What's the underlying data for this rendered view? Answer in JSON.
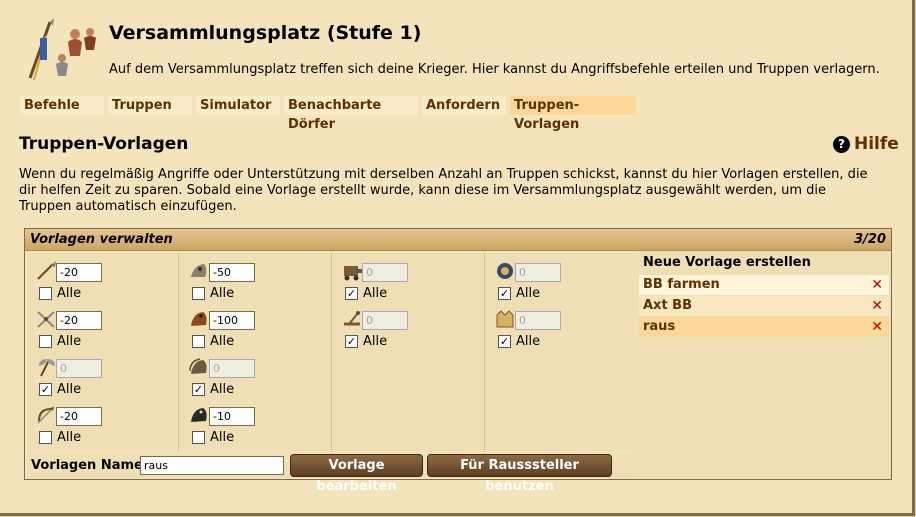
{
  "header": {
    "title": "Versammlungsplatz (Stufe 1)",
    "description": "Auf dem Versammlungsplatz treffen sich deine Krieger. Hier kannst du Angriffsbefehle erteilen und Truppen verlagern."
  },
  "tabs": [
    {
      "label": "Befehle",
      "selected": false
    },
    {
      "label": "Truppen",
      "selected": false
    },
    {
      "label": "Simulator",
      "selected": false
    },
    {
      "label": "Benachbarte Dörfer",
      "selected": false
    },
    {
      "label": "Anfordern",
      "selected": false
    },
    {
      "label": "Truppen-Vorlagen",
      "selected": true
    }
  ],
  "section": {
    "title": "Truppen-Vorlagen",
    "help_label": "Hilfe",
    "help_icon": "question-mark",
    "intro": "Wenn du regelmäßig Angriffe oder Unterstützung mit derselben Anzahl an Truppen schickst, kannst du hier Vorlagen erstellen, die dir helfen Zeit zu sparen. Sobald eine Vorlage erstellt wurde, kann diese im Versammlungsplatz ausgewählt werden, um die Truppen automatisch einzufügen."
  },
  "manage": {
    "title": "Vorlagen verwalten",
    "count": "3/20",
    "all_label": "Alle",
    "units": [
      {
        "unit": "spear",
        "value": "-20",
        "enabled": true,
        "all_checked": false
      },
      {
        "unit": "sword",
        "value": "-20",
        "enabled": true,
        "all_checked": false
      },
      {
        "unit": "axe",
        "value": "0",
        "enabled": false,
        "all_checked": true
      },
      {
        "unit": "archer",
        "value": "-20",
        "enabled": true,
        "all_checked": false
      },
      {
        "unit": "spy",
        "value": "-50",
        "enabled": true,
        "all_checked": false
      },
      {
        "unit": "light-cavalry",
        "value": "-100",
        "enabled": true,
        "all_checked": false
      },
      {
        "unit": "mounted-archer",
        "value": "0",
        "enabled": false,
        "all_checked": true
      },
      {
        "unit": "heavy-cavalry",
        "value": "-10",
        "enabled": true,
        "all_checked": false
      },
      {
        "unit": "ram",
        "value": "0",
        "enabled": false,
        "all_checked": true
      },
      {
        "unit": "catapult",
        "value": "0",
        "enabled": false,
        "all_checked": true
      },
      {
        "unit": "paladin",
        "value": "0",
        "enabled": false,
        "all_checked": true
      },
      {
        "unit": "nobleman",
        "value": "0",
        "enabled": false,
        "all_checked": true
      }
    ],
    "name_label": "Vorlagen Name:",
    "name_value": "raus",
    "edit_button": "Vorlage bearbeiten",
    "use_button": "Für Rausssteller benutzen"
  },
  "templates": {
    "new_label": "Neue Vorlage erstellen",
    "items": [
      {
        "name": "BB farmen",
        "selected": false
      },
      {
        "name": "Axt BB",
        "selected": false
      },
      {
        "name": "raus",
        "selected": true
      }
    ],
    "delete_glyph": "✕"
  },
  "colors": {
    "background": "#f4e4bc",
    "link_brown": "#603000",
    "selected_tab": "#fcd898",
    "delete_red": "#c00000"
  }
}
